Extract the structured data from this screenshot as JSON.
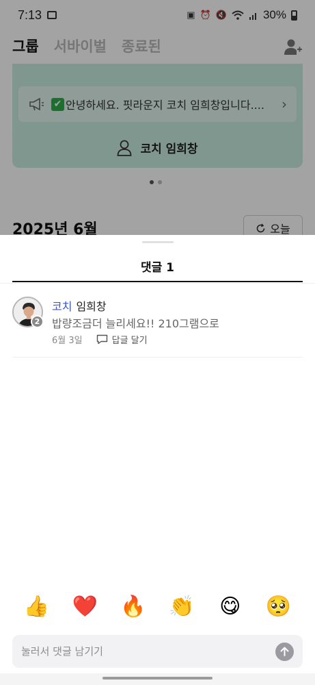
{
  "status_bar": {
    "time": "7:13",
    "battery": "30%"
  },
  "tabs": [
    {
      "label": "그룹",
      "active": true
    },
    {
      "label": "서바이벌",
      "active": false
    },
    {
      "label": "종료된",
      "active": false
    }
  ],
  "notice": {
    "text": "안녕하세요. 핏라운지 코치 임희창입니다...."
  },
  "coach_line": {
    "label": "코치 임희창"
  },
  "month_title": "2025년 6월",
  "today_button": "오늘",
  "sheet": {
    "title": "댓글 1",
    "comment": {
      "role": "코치",
      "name": "임희창",
      "badge": "2",
      "text": "밥량조금더 늘리세요!! 210그램으로",
      "date": "6월 3일",
      "reply_label": "답글 달기"
    },
    "emojis": [
      "👍",
      "❤️",
      "🔥",
      "👏",
      "😋",
      "🥺"
    ],
    "input_placeholder": "눌러서 댓글 남기기"
  },
  "colors": {
    "accent_blue": "#3b56d6",
    "card_green": "#c9ede0",
    "scrim": "rgba(0,0,0,0.36)"
  }
}
